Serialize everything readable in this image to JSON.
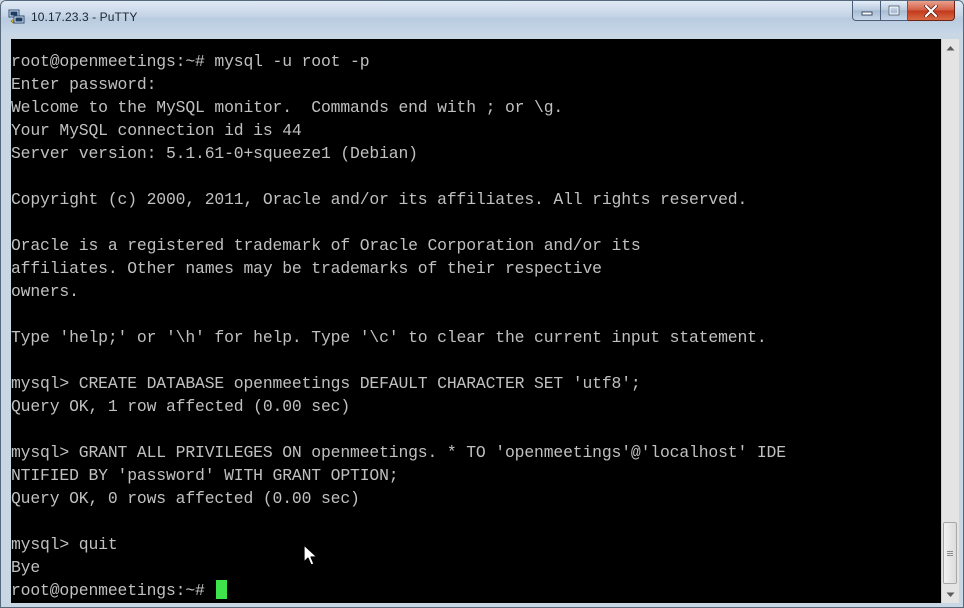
{
  "window": {
    "title": "10.17.23.3 - PuTTY"
  },
  "terminal": {
    "lines": [
      "root@openmeetings:~# mysql -u root -p",
      "Enter password:",
      "Welcome to the MySQL monitor.  Commands end with ; or \\g.",
      "Your MySQL connection id is 44",
      "Server version: 5.1.61-0+squeeze1 (Debian)",
      "",
      "Copyright (c) 2000, 2011, Oracle and/or its affiliates. All rights reserved.",
      "",
      "Oracle is a registered trademark of Oracle Corporation and/or its",
      "affiliates. Other names may be trademarks of their respective",
      "owners.",
      "",
      "Type 'help;' or '\\h' for help. Type '\\c' to clear the current input statement.",
      "",
      "mysql> CREATE DATABASE openmeetings DEFAULT CHARACTER SET 'utf8';",
      "Query OK, 1 row affected (0.00 sec)",
      "",
      "mysql> GRANT ALL PRIVILEGES ON openmeetings. * TO 'openmeetings'@'localhost' IDE",
      "NTIFIED BY 'password' WITH GRANT OPTION;",
      "Query OK, 0 rows affected (0.00 sec)",
      "",
      "mysql> quit",
      "Bye"
    ],
    "prompt": "root@openmeetings:~# ",
    "cursor_color": "#3ee24a",
    "text_color": "#c0c0c0",
    "background_color": "#000000"
  },
  "icons": {
    "app": "putty-icon",
    "minimize": "minimize-icon",
    "maximize": "maximize-icon",
    "close": "close-icon",
    "scroll_up": "arrow-up-icon",
    "scroll_down": "arrow-down-icon",
    "pointer": "mouse-pointer-icon"
  }
}
